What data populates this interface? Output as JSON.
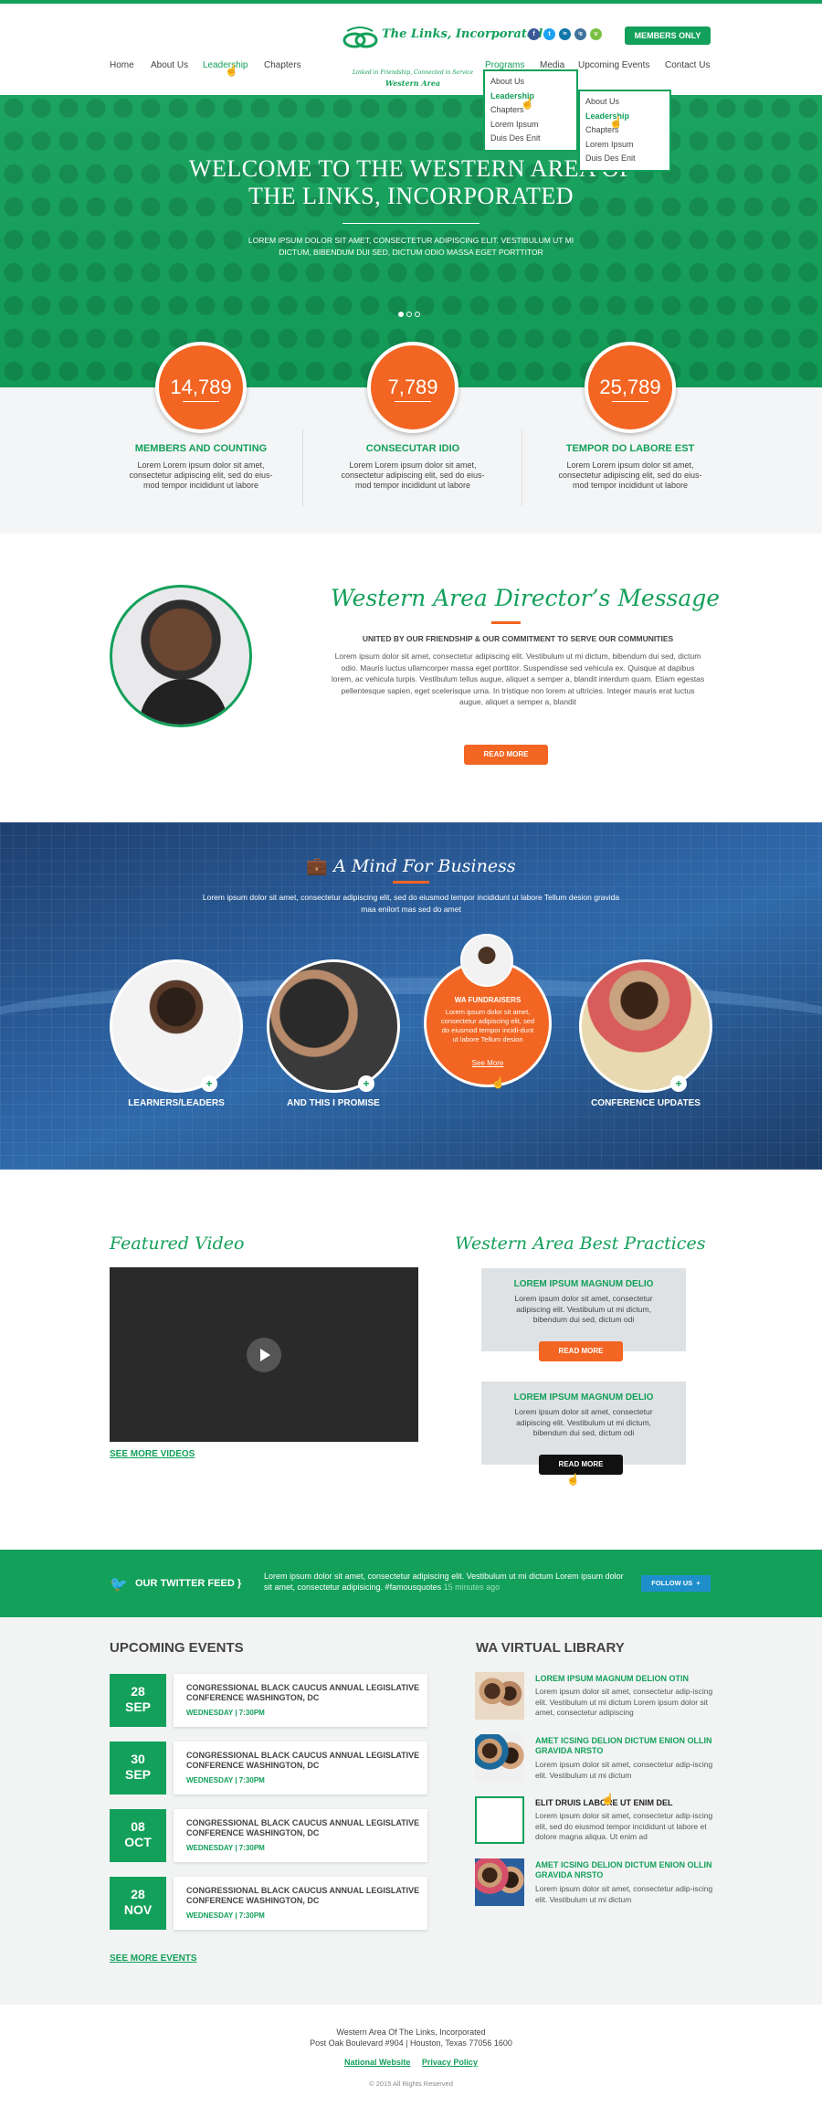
{
  "header": {
    "nav_left": [
      "Home",
      "About Us",
      "Leadership",
      "Chapters"
    ],
    "nav_right": [
      "Programs",
      "Media",
      "Upcoming Events",
      "Contact Us"
    ],
    "logo": {
      "name": "The Links, Incorporated",
      "tagline": "Linked in Friendship, Connected in Service",
      "region": "Western Area"
    },
    "social": [
      "f",
      "t",
      "in",
      "ig",
      "v"
    ],
    "members_button": "MEMBERS ONLY",
    "dropdown_programs": [
      "About Us",
      "Leadership",
      "Chapters",
      "Lorem Ipsum",
      "Duis Des Enit"
    ],
    "dropdown_media": [
      "About Us",
      "Leadership",
      "Chapters",
      "Lorem Ipsum",
      "Duis Des Enit"
    ]
  },
  "hero": {
    "title_line1": "WELCOME TO THE WESTERN AREA OF",
    "title_line2": "THE LINKS, INCORPORATED",
    "text": "LOREM IPSUM DOLOR SIT AMET, CONSECTETUR ADIPISCING ELIT. VESTIBULUM UT MI DICTUM, BIBENDUM DUI SED, DICTUM ODIO MASSA EGET PORTTITOR",
    "slides": 3,
    "active_slide": 1
  },
  "stats": [
    {
      "value": "14,789",
      "label": "MEMBERS AND COUNTING",
      "text": "Lorem Lorem ipsum dolor sit amet, consectetur adipiscing elit, sed do eius-mod tempor incididunt ut labore"
    },
    {
      "value": "7,789",
      "label": "CONSECUTAR IDIO",
      "text": "Lorem Lorem ipsum dolor sit amet, consectetur adipiscing elit, sed do eius-mod tempor incididunt ut labore"
    },
    {
      "value": "25,789",
      "label": "TEMPOR DO LABORE EST",
      "text": "Lorem Lorem ipsum dolor sit amet, consectetur adipiscing elit, sed do eius-mod tempor incididunt ut labore"
    }
  ],
  "director": {
    "title": "Western Area Director’s Message",
    "subtitle": "UNITED BY OUR FRIENDSHIP & OUR COMMITMENT TO SERVE OUR COMMUNITIES",
    "text": "Lorem ipsum dolor sit amet, consectetur adipiscing elit. Vestibulum ut mi dictum, bibendum dui sed, dictum odio. Mauris luctus ullamcorper massa eget porttitor. Suspendisse sed vehicula ex. Quisque at dapibus lorem, ac vehicula turpis. Vestibulum tellus augue, aliquet a semper a, blandit interdum quam. Etiam egestas pellentesque sapien, eget scelerisque urna. In tristique non lorem at ultricies. Integer mauris erat luctus augue, aliquet a semper a, blandit",
    "button": "READ MORE"
  },
  "business": {
    "title": "A Mind For Business",
    "text": "Lorem ipsum dolor sit amet, consectetur adipiscing elit, sed do eiusmod tempor incididunt ut labore Tellum desion gravida maa enilort mas sed do amet",
    "items": [
      "LEARNERS/LEADERS",
      "AND THIS I PROMISE",
      "CONFERENCE UPDATES"
    ],
    "fundraisers": {
      "title": "WA FUNDRAISERS",
      "text": "Lorem ipsum dolor sit amet, consectetur adipiscing elit, sed do eiusmod tempor incidi-dunt ut labore Tellum desion",
      "link": "See More"
    }
  },
  "video": {
    "title": "Featured Video",
    "more": "SEE MORE VIDEOS"
  },
  "practices": {
    "title": "Western Area Best Practices",
    "items": [
      {
        "title": "LOREM IPSUM MAGNUM DELIO",
        "text": "Lorem ipsum dolor sit amet, consectetur adipiscing elit. Vestibulum ut mi dictum, bibendum dui sed, dictum odi",
        "button": "READ MORE"
      },
      {
        "title": "LOREM IPSUM MAGNUM DELIO",
        "text": "Lorem ipsum dolor sit amet, consectetur adipiscing elit. Vestibulum ut mi dictum, bibendum dui sed, dictum odi",
        "button": "READ MORE"
      }
    ]
  },
  "twitter": {
    "title": "OUR TWITTER FEED",
    "text": "Lorem ipsum dolor sit amet, consectetur adipiscing elit. Vestibulum ut mi dictum Lorem ipsum dolor sit amet, consectetur adipisicing. #famousquotes",
    "ago": "15 minutes ago",
    "follow": "FOLLOW US"
  },
  "events": {
    "title": "UPCOMING EVENTS",
    "items": [
      {
        "day": "28",
        "month": "SEP",
        "title": "CONGRESSIONAL BLACK CAUCUS ANNUAL LEGISLATIVE CONFERENCE WASHINGTON, DC",
        "when": "WEDNESDAY | 7:30PM"
      },
      {
        "day": "30",
        "month": "SEP",
        "title": "CONGRESSIONAL BLACK CAUCUS ANNUAL LEGISLATIVE CONFERENCE WASHINGTON, DC",
        "when": "WEDNESDAY | 7:30PM"
      },
      {
        "day": "08",
        "month": "OCT",
        "title": "CONGRESSIONAL BLACK CAUCUS ANNUAL LEGISLATIVE CONFERENCE WASHINGTON, DC",
        "when": "WEDNESDAY | 7:30PM"
      },
      {
        "day": "28",
        "month": "NOV",
        "title": "CONGRESSIONAL BLACK CAUCUS ANNUAL LEGISLATIVE CONFERENCE WASHINGTON, DC",
        "when": "WEDNESDAY | 7:30PM"
      }
    ],
    "more": "SEE MORE EVENTS"
  },
  "library": {
    "title": "WA VIRTUAL LIBRARY",
    "items": [
      {
        "title": "LOREM IPSUM MAGNUM DELION OTIN",
        "text": "Lorem ipsum dolor sit amet, consectetur adip-iscing elit. Vestibulum ut mi dictum Lorem ipsum dolor sit amet, consectetur adipiscing"
      },
      {
        "title": "AMET ICSING DELION DICTUM ENION OLLIN GRAVIDA NRSTO",
        "text": "Lorem ipsum dolor sit amet, consectetur adip-iscing elit. Vestibulum ut mi dictum"
      },
      {
        "title": "ELIT DRUIS LABORE UT ENIM DEL",
        "text": "Lorem ipsum dolor sit amet, consectetur adip-iscing elit, sed do eiusmod tempor incididunt ut labore et dolore magna aliqua. Ut enim ad"
      },
      {
        "title": "AMET ICSING DELION DICTUM ENION OLLIN GRAVIDA NRSTO",
        "text": "Lorem ipsum dolor sit amet, consectetur adip-iscing elit. Vestibulum ut mi dictum"
      }
    ]
  },
  "footer": {
    "org": "Western Area Of The Links, Incorporated",
    "address": "Post Oak Boulevard #904 | Houston, Texas 77056 1600",
    "links": [
      "National Website",
      "Privacy Policy"
    ],
    "copyright": "© 2015 All Rights Reserved"
  },
  "colors": {
    "green": "#13a05a",
    "orange": "#f26522",
    "blue": "#2d64a5"
  }
}
